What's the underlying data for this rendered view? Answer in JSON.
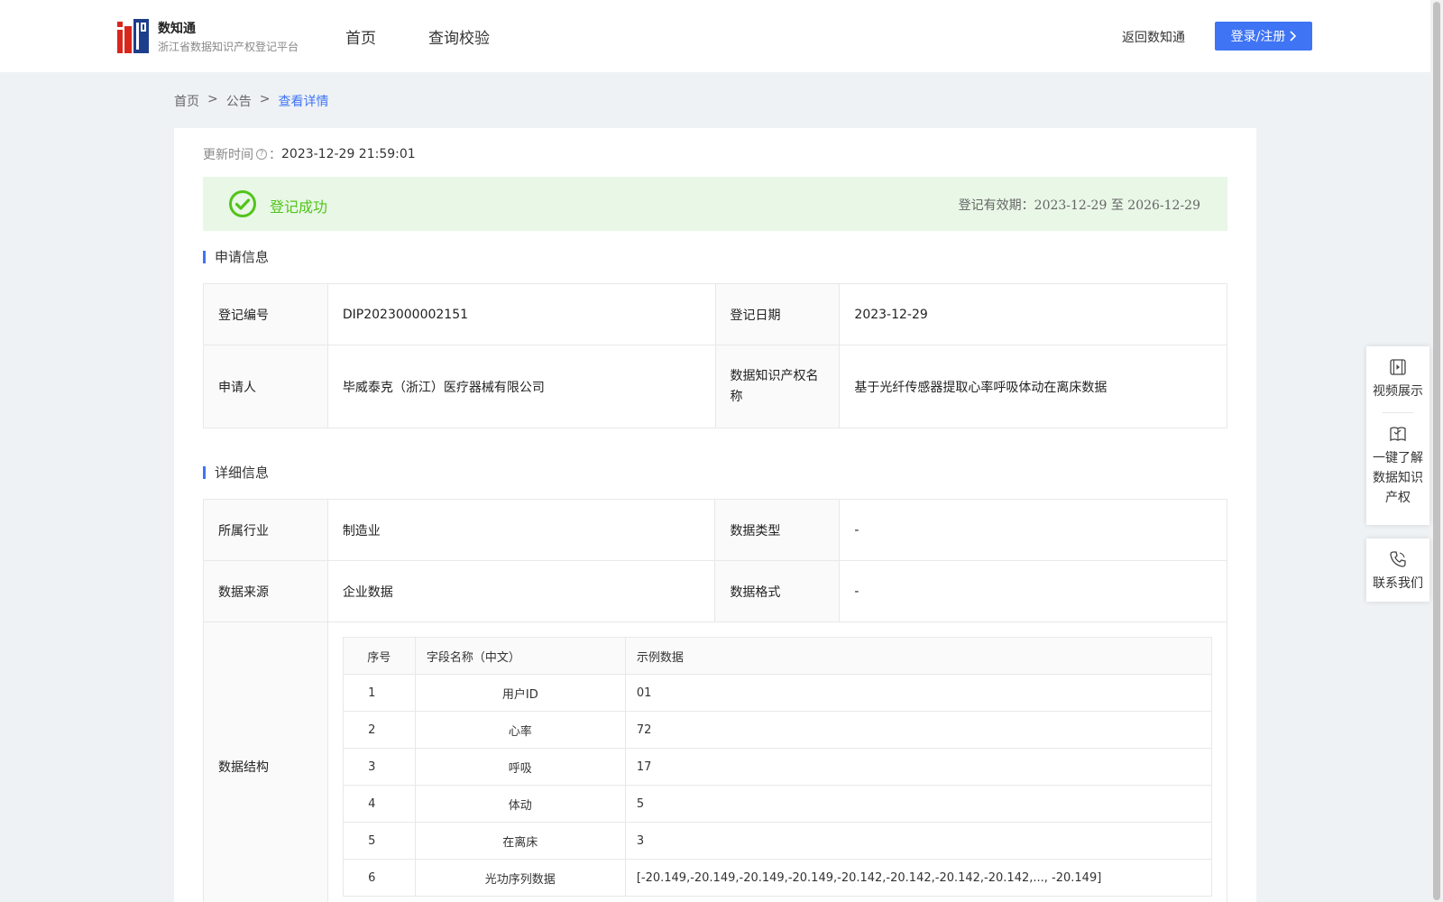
{
  "header": {
    "brand_name": "数知通",
    "brand_sub": "浙江省数据知识产权登记平台",
    "nav": [
      {
        "label": "首页"
      },
      {
        "label": "查询校验"
      }
    ],
    "back_label": "返回数知通",
    "login_label": "登录/注册"
  },
  "breadcrumb": {
    "items": [
      "首页",
      "公告",
      "查看详情"
    ],
    "separator": ">"
  },
  "update": {
    "label": "更新时间",
    "value": "2023-12-29 21:59:01"
  },
  "status": {
    "text": "登记成功",
    "validity_label": "登记有效期：",
    "validity_start": "2023-12-29",
    "validity_sep": "至",
    "validity_end": "2026-12-29",
    "color": "#52c41a"
  },
  "application": {
    "title": "申请信息",
    "rows": [
      {
        "k1": "登记编号",
        "v1": "DIP2023000002151",
        "k2": "登记日期",
        "v2": "2023-12-29"
      },
      {
        "k1": "申请人",
        "v1": "毕威泰克（浙江）医疗器械有限公司",
        "k2": "数据知识产权名称",
        "v2": "基于光纤传感器提取心率呼吸体动在离床数据"
      }
    ]
  },
  "details": {
    "title": "详细信息",
    "rows": [
      {
        "k1": "所属行业",
        "v1": "制造业",
        "k2": "数据类型",
        "v2": "-"
      },
      {
        "k1": "数据来源",
        "v1": "企业数据",
        "k2": "数据格式",
        "v2": "-"
      }
    ],
    "structure_label": "数据结构",
    "structure": {
      "headers": [
        "序号",
        "字段名称（中文）",
        "示例数据"
      ],
      "rows": [
        {
          "idx": "1",
          "name": "用户ID",
          "example": "01"
        },
        {
          "idx": "2",
          "name": "心率",
          "example": "72"
        },
        {
          "idx": "3",
          "name": "呼吸",
          "example": "17"
        },
        {
          "idx": "4",
          "name": "体动",
          "example": "5"
        },
        {
          "idx": "5",
          "name": "在离床",
          "example": "3"
        },
        {
          "idx": "6",
          "name": "光功序列数据",
          "example": "[-20.149,-20.149,-20.149,-20.149,-20.142,-20.142,-20.142,-20.142,..., -20.149]"
        }
      ]
    }
  },
  "side": {
    "video": "视频展示",
    "learn": [
      "一键了解",
      "数据知识",
      "产权"
    ],
    "contact": "联系我们"
  },
  "colors": {
    "primary": "#3f74f4",
    "success": "#52c41a",
    "success_bg": "#e8f7e6",
    "logo_blue": "#1d3e8a",
    "logo_red": "#d9261c"
  }
}
